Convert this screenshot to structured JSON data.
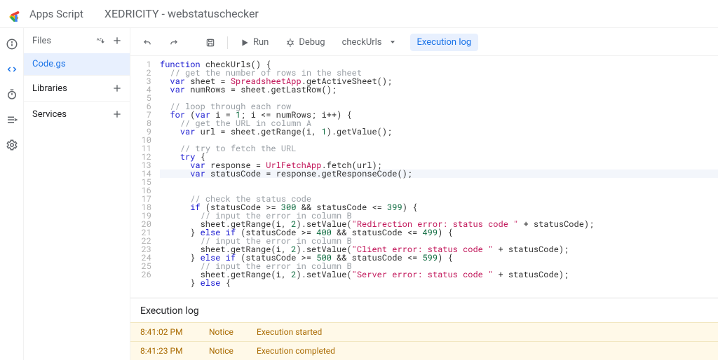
{
  "header": {
    "app_name": "Apps Script",
    "project_title": "XEDRICITY - webstatuschecker"
  },
  "sidebar": {
    "files_label": "Files",
    "files": [
      "Code.gs"
    ],
    "libraries_label": "Libraries",
    "services_label": "Services"
  },
  "toolbar": {
    "run": "Run",
    "debug": "Debug",
    "function": "checkUrls",
    "exec_log": "Execution log"
  },
  "code": {
    "lines": [
      {
        "n": 1,
        "seg": [
          [
            "kw",
            "function"
          ],
          [
            "op",
            " "
          ],
          [
            "fn",
            "checkUrls"
          ],
          [
            "op",
            "() {"
          ]
        ]
      },
      {
        "n": 2,
        "seg": [
          [
            "op",
            "  "
          ],
          [
            "cm",
            "// get the number of rows in the sheet"
          ]
        ]
      },
      {
        "n": 3,
        "seg": [
          [
            "op",
            "  "
          ],
          [
            "kw",
            "var"
          ],
          [
            "op",
            " sheet = "
          ],
          [
            "idb",
            "SpreadsheetApp"
          ],
          [
            "op",
            ".getActiveSheet();"
          ]
        ]
      },
      {
        "n": 4,
        "seg": [
          [
            "op",
            "  "
          ],
          [
            "kw",
            "var"
          ],
          [
            "op",
            " numRows = sheet.getLastRow();"
          ]
        ]
      },
      {
        "n": 5,
        "seg": [
          [
            "op",
            ""
          ]
        ]
      },
      {
        "n": 6,
        "seg": [
          [
            "op",
            "  "
          ],
          [
            "cm",
            "// loop through each row"
          ]
        ]
      },
      {
        "n": 7,
        "seg": [
          [
            "op",
            "  "
          ],
          [
            "kw",
            "for"
          ],
          [
            "op",
            " ("
          ],
          [
            "kw",
            "var"
          ],
          [
            "op",
            " i = "
          ],
          [
            "num",
            "1"
          ],
          [
            "op",
            "; i <= numRows; i++) {"
          ]
        ]
      },
      {
        "n": 8,
        "seg": [
          [
            "op",
            "    "
          ],
          [
            "cm",
            "// get the URL in column A"
          ]
        ]
      },
      {
        "n": 9,
        "seg": [
          [
            "op",
            "    "
          ],
          [
            "kw",
            "var"
          ],
          [
            "op",
            " url = sheet.getRange(i, "
          ],
          [
            "num",
            "1"
          ],
          [
            "op",
            ").getValue();"
          ]
        ]
      },
      {
        "n": 10,
        "seg": [
          [
            "op",
            ""
          ]
        ]
      },
      {
        "n": 11,
        "seg": [
          [
            "op",
            "    "
          ],
          [
            "cm",
            "// try to fetch the URL"
          ]
        ]
      },
      {
        "n": 12,
        "seg": [
          [
            "op",
            "    "
          ],
          [
            "kw",
            "try"
          ],
          [
            "op",
            " {"
          ]
        ]
      },
      {
        "n": 13,
        "seg": [
          [
            "op",
            "      "
          ],
          [
            "kw",
            "var"
          ],
          [
            "op",
            " response = "
          ],
          [
            "idb",
            "UrlFetchApp"
          ],
          [
            "op",
            ".fetch(url);"
          ]
        ]
      },
      {
        "n": 14,
        "hl": true,
        "seg": [
          [
            "op",
            "      "
          ],
          [
            "kw",
            "var"
          ],
          [
            "op",
            " statusCode = response.getResponseCode();"
          ]
        ]
      },
      {
        "n": 15,
        "seg": [
          [
            "op",
            ""
          ]
        ]
      },
      {
        "n": 16,
        "seg": [
          [
            "op",
            "      "
          ],
          [
            "cm",
            "// check the status code"
          ]
        ]
      },
      {
        "n": 17,
        "seg": [
          [
            "op",
            "      "
          ],
          [
            "kw",
            "if"
          ],
          [
            "op",
            " (statusCode >= "
          ],
          [
            "num",
            "300"
          ],
          [
            "op",
            " && statusCode <= "
          ],
          [
            "num",
            "399"
          ],
          [
            "op",
            ") {"
          ]
        ]
      },
      {
        "n": 18,
        "seg": [
          [
            "op",
            "        "
          ],
          [
            "cm",
            "// input the error in column B"
          ]
        ]
      },
      {
        "n": 19,
        "seg": [
          [
            "op",
            "        sheet.getRange(i, "
          ],
          [
            "num",
            "2"
          ],
          [
            "op",
            ").setValue("
          ],
          [
            "str",
            "\"Redirection error: status code \""
          ],
          [
            "op",
            " + statusCode);"
          ]
        ]
      },
      {
        "n": 20,
        "seg": [
          [
            "op",
            "      } "
          ],
          [
            "kw",
            "else if"
          ],
          [
            "op",
            " (statusCode >= "
          ],
          [
            "num",
            "400"
          ],
          [
            "op",
            " && statusCode <= "
          ],
          [
            "num",
            "499"
          ],
          [
            "op",
            ") {"
          ]
        ]
      },
      {
        "n": 21,
        "seg": [
          [
            "op",
            "        "
          ],
          [
            "cm",
            "// input the error in column B"
          ]
        ]
      },
      {
        "n": 22,
        "seg": [
          [
            "op",
            "        sheet.getRange(i, "
          ],
          [
            "num",
            "2"
          ],
          [
            "op",
            ").setValue("
          ],
          [
            "str",
            "\"Client error: status code \""
          ],
          [
            "op",
            " + statusCode);"
          ]
        ]
      },
      {
        "n": 23,
        "seg": [
          [
            "op",
            "      } "
          ],
          [
            "kw",
            "else if"
          ],
          [
            "op",
            " (statusCode >= "
          ],
          [
            "num",
            "500"
          ],
          [
            "op",
            " && statusCode <= "
          ],
          [
            "num",
            "599"
          ],
          [
            "op",
            ") {"
          ]
        ]
      },
      {
        "n": 24,
        "seg": [
          [
            "op",
            "        "
          ],
          [
            "cm",
            "// input the error in column B"
          ]
        ]
      },
      {
        "n": 25,
        "seg": [
          [
            "op",
            "        sheet.getRange(i, "
          ],
          [
            "num",
            "2"
          ],
          [
            "op",
            ").setValue("
          ],
          [
            "str",
            "\"Server error: status code \""
          ],
          [
            "op",
            " + statusCode);"
          ]
        ]
      },
      {
        "n": 26,
        "seg": [
          [
            "op",
            "      } "
          ],
          [
            "kw",
            "else"
          ],
          [
            "op",
            " {"
          ]
        ]
      }
    ]
  },
  "exec": {
    "title": "Execution log",
    "rows": [
      {
        "t": "8:41:02 PM",
        "lvl": "Notice",
        "msg": "Execution started"
      },
      {
        "t": "8:41:23 PM",
        "lvl": "Notice",
        "msg": "Execution completed"
      }
    ]
  }
}
